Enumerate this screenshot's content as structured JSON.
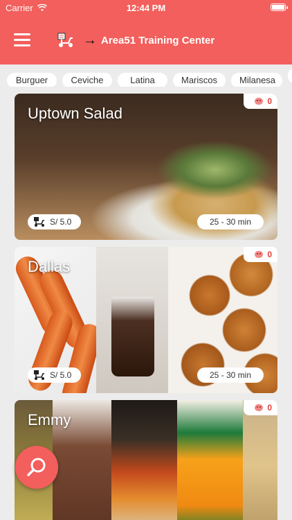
{
  "status_bar": {
    "carrier": "Carrier",
    "time": "12:44 PM"
  },
  "header": {
    "title": "Area51 Training Center",
    "menu_icon": "hamburger-menu-icon",
    "logo_icon": "scooter-delivery-icon",
    "arrow_icon": "arrow-right-icon"
  },
  "categories": [
    "Burguer",
    "Ceviche",
    "Latina",
    "Mariscos",
    "Milanesa"
  ],
  "restaurants": [
    {
      "name": "Uptown Salad",
      "likes": "0",
      "fee": "S/ 5.0",
      "eta": "25 - 30 min"
    },
    {
      "name": "Dallas",
      "likes": "0",
      "fee": "S/ 5.0",
      "eta": "25 - 30 min"
    },
    {
      "name": "Emmy",
      "likes": "0"
    }
  ],
  "fab": {
    "icon": "search-icon"
  },
  "colors": {
    "primary": "#f25f5c",
    "likes_text": "#e0413d"
  }
}
